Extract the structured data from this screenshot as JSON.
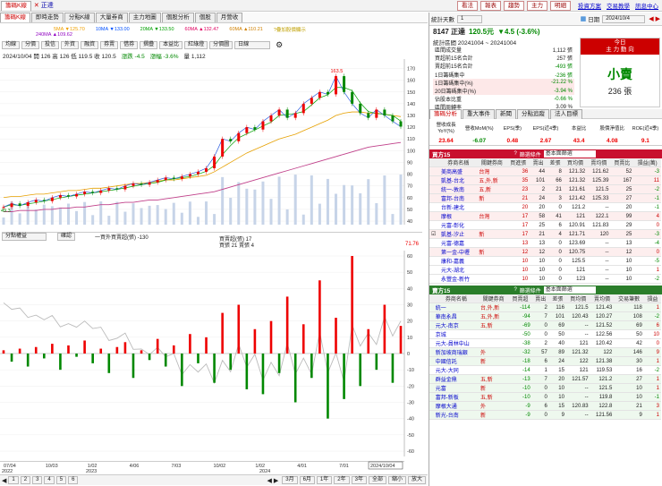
{
  "window": {
    "tab_label": "籌碼K線",
    "stock_label": "正達",
    "top_buttons": [
      "看法",
      "報表",
      "趨勢",
      "主力",
      "明細"
    ],
    "top_links": [
      "投資方案",
      "交易教學",
      "訊息中心"
    ]
  },
  "toolbar": {
    "tabs": [
      "籌碼K線",
      "即時走勢",
      "分點K線",
      "大量券商",
      "主力地圖",
      "個股分析",
      "個股",
      "月營收"
    ],
    "time_label": "日期",
    "date_value": "2024/10/4",
    "stat_label": "統計天數",
    "stat_days": "1"
  },
  "chart_controls": {
    "buttons": [
      "均線",
      "分價",
      "投信",
      "外資",
      "融資",
      "券賣",
      "借券",
      "摺疊",
      "本益比",
      "紅綠燈",
      "分價圖",
      "日線"
    ],
    "info": "2024/10/04 開 126 高 126 低 119.5 收 120.5",
    "change": "漲跌 -4.5",
    "pct": "漲幅 -3.6%",
    "volume": "量 1,112",
    "indicator_dropdown": "分點權益",
    "indicator_button": "確認",
    "indicator_info": "一買外買賣超(張) -130",
    "indicator_info2": "買賣超(張) 17",
    "indicator_info3": "買張 21 賣張 4",
    "right_value": "71.76",
    "tool_buttons": [
      "3月",
      "6月",
      "1年",
      "2年",
      "3年",
      "全部",
      "縮小",
      "放大"
    ],
    "page_tabs": [
      "1",
      "2",
      "3",
      "4",
      "5",
      "6"
    ]
  },
  "legend": {
    "items": [
      "5MA ▼125.70",
      "10MA ▼133.00",
      "20MA ▼133.50",
      "60MA ▲132.47",
      "60MA ▲110.21"
    ],
    "items2": [
      "240MA ▲109.62"
    ],
    "tip": "?疊加股價顯示"
  },
  "chart_data": {
    "type": "line",
    "title": "",
    "price_axis": [
      170,
      160,
      150,
      140,
      130,
      120,
      110,
      100,
      90,
      80,
      70,
      60,
      50,
      40
    ],
    "indicator_axis": [
      60,
      50,
      40,
      30,
      20,
      10,
      0,
      -10,
      -20,
      -30,
      -40,
      -50,
      -60
    ],
    "x_ticks": [
      "07/04",
      "10/03",
      "1/02",
      "4/06",
      "7/03",
      "10/02",
      "1/02",
      "4/01",
      "7/01",
      "2024/10/04"
    ],
    "year_labels": [
      "2022",
      "2023",
      "2024"
    ],
    "peak_label": "163.5",
    "low_label": "49.3",
    "ylim": [
      40,
      175
    ],
    "close": [
      52,
      55,
      53,
      56,
      58,
      57,
      60,
      62,
      61,
      63,
      65,
      64,
      66,
      68,
      67,
      70,
      72,
      71,
      73,
      75,
      77,
      76,
      78,
      80,
      82,
      85,
      95,
      110,
      108,
      115,
      120,
      118,
      125,
      130,
      135,
      128,
      132,
      140,
      145,
      150,
      148,
      163.5,
      150,
      140,
      132,
      128,
      135,
      130,
      125,
      120.5
    ],
    "ma_line": [
      60,
      61,
      61,
      62,
      63,
      63,
      64,
      65,
      66,
      66,
      67,
      68,
      68,
      69,
      70,
      71,
      72,
      72,
      73,
      74,
      75,
      75,
      76,
      77,
      78,
      79,
      82,
      86,
      90,
      94,
      98,
      101,
      104,
      107,
      110,
      112,
      114,
      117,
      120,
      123,
      126,
      130,
      132,
      133,
      133,
      132,
      132,
      131,
      130,
      129
    ],
    "long_ma": [
      48,
      48,
      49,
      49,
      49,
      50,
      50,
      51,
      51,
      52,
      52,
      53,
      54,
      54,
      55,
      56,
      56,
      57,
      58,
      58,
      59,
      60,
      61,
      62,
      63,
      64,
      65,
      67,
      69,
      71,
      73,
      75,
      77,
      79,
      81,
      83,
      85,
      87,
      89,
      91,
      93,
      95,
      97,
      99,
      101,
      103,
      104,
      105,
      106,
      107
    ],
    "net_buy": [
      2,
      -5,
      3,
      -8,
      4,
      -3,
      6,
      -10,
      5,
      -2,
      8,
      -6,
      3,
      -12,
      4,
      7,
      -15,
      2,
      -4,
      9,
      -8,
      5,
      -20,
      12,
      -6,
      10,
      -18,
      25,
      -10,
      30,
      -22,
      15,
      -25,
      20,
      -12,
      35,
      -30,
      18,
      -15,
      45,
      -40,
      22,
      -28,
      60,
      -20,
      15,
      -10,
      30,
      -18,
      17
    ]
  },
  "right_panel": {
    "stock_title": "8147 正達",
    "price": "120.5元",
    "change": "▼4.5 (-3.6%)",
    "period": "統計區間 20241004 ~ 20241004",
    "stats": [
      {
        "label": "區間成交量",
        "value": "1,112 張"
      },
      {
        "label": "買超前15名合計",
        "value": "257 張"
      },
      {
        "label": "賣超前15名合計",
        "value": "-493 張"
      },
      {
        "label": "1日籌碼集中",
        "value": "-236 張"
      },
      {
        "label": "1日籌碼集中(%)",
        "value": "-21.22 %"
      },
      {
        "label": "20日籌碼集中(%)",
        "value": "-3.94 %"
      },
      {
        "label": "佔股本比重",
        "value": "-0.66 %"
      },
      {
        "label": "區間周轉率",
        "value": "3.09 %"
      }
    ],
    "today_box": {
      "header": "今日",
      "sub": "主 力 動 向",
      "main": "小賣",
      "amount": "236 張"
    },
    "sub_tabs": [
      "籌碼分析",
      "重大事件",
      "新聞",
      "分點追蹤",
      "法人目標"
    ],
    "metrics": [
      {
        "label": "營收成長YoY(%)",
        "value": "23.64"
      },
      {
        "label": "營收MoM(%)",
        "value": "-6.07"
      },
      {
        "label": "EPS(季)",
        "value": "0.48"
      },
      {
        "label": "EPS(近4季)",
        "value": "2.67"
      },
      {
        "label": "本益比",
        "value": "43.4"
      },
      {
        "label": "股價淨值比",
        "value": "4.08"
      },
      {
        "label": "ROE(近4季)",
        "value": "9.1"
      }
    ]
  },
  "buy_table": {
    "title": "買方15",
    "dropdown_label": "篩選條件",
    "dropdown_value": "基本面篩選",
    "columns": [
      "",
      "券商名稱",
      "關鍵券商",
      "買進張",
      "賣出",
      "差張",
      "買均價",
      "賣均價",
      "買賣比",
      "損益(萬)"
    ],
    "rows": [
      [
        "",
        "美商高盛",
        "台灣",
        "36",
        "44",
        "8",
        "121.32",
        "121.62",
        "52",
        "-3"
      ],
      [
        "",
        "凱基-台北",
        "五,外,新",
        "35",
        "101",
        "66",
        "121.32",
        "125.39",
        "167",
        "11"
      ],
      [
        "",
        "統一-敦南",
        "五,新",
        "23",
        "2",
        "21",
        "121.61",
        "121.5",
        "25",
        "-2"
      ],
      [
        "",
        "富邦-台南",
        "新",
        "21",
        "24",
        "3",
        "121.42",
        "125.33",
        "27",
        "-1"
      ],
      [
        "",
        "台新-建北",
        "",
        "20",
        "20",
        "0",
        "121.2",
        "--",
        "20",
        "-1"
      ],
      [
        "",
        "摩根",
        "台灣",
        "17",
        "58",
        "41",
        "121",
        "122.1",
        "99",
        "4"
      ],
      [
        "",
        "元富-彰化",
        "",
        "17",
        "25",
        "6",
        "120.91",
        "121.83",
        "29",
        "0"
      ],
      [
        "☑",
        "凱基-汐止",
        "新",
        "17",
        "21",
        "4",
        "121.71",
        "120",
        "25",
        "-3"
      ],
      [
        "",
        "元富-德嘉",
        "",
        "13",
        "13",
        "0",
        "123.69",
        "--",
        "13",
        "-4"
      ],
      [
        "",
        "第一金-中壢",
        "新",
        "12",
        "12",
        "0",
        "120.75",
        "--",
        "12",
        "0"
      ],
      [
        "",
        "康和-嘉義",
        "",
        "10",
        "10",
        "0",
        "125.5",
        "--",
        "10",
        "-5"
      ],
      [
        "",
        "元大-湖北",
        "",
        "10",
        "10",
        "0",
        "121",
        "--",
        "10",
        "1"
      ],
      [
        "",
        "永豐金-新竹",
        "",
        "10",
        "10",
        "0",
        "123",
        "--",
        "10",
        "-2"
      ]
    ]
  },
  "sell_table": {
    "title": "賣方15",
    "dropdown_label": "篩選條件",
    "dropdown_value": "基本面篩選",
    "columns": [
      "",
      "券商名稱",
      "關鍵券商",
      "買賣超",
      "賣出",
      "差張",
      "買均價",
      "賣均價",
      "交易筆數",
      "損益"
    ],
    "rows": [
      [
        "",
        "統一",
        "台,外,新",
        "-114",
        "2",
        "116",
        "121.5",
        "121.43",
        "118",
        "1"
      ],
      [
        "",
        "華南永昌",
        "五,外,新",
        "-94",
        "7",
        "101",
        "120.43",
        "120.27",
        "108",
        "-2"
      ],
      [
        "",
        "元大-南京",
        "五,新",
        "-69",
        "0",
        "69",
        "--",
        "121.52",
        "69",
        "6"
      ],
      [
        "",
        "京城",
        "",
        "-50",
        "0",
        "50",
        "--",
        "122.56",
        "50",
        "10"
      ],
      [
        "",
        "元大-員林中山",
        "",
        "-38",
        "2",
        "40",
        "121",
        "120.42",
        "42",
        "0"
      ],
      [
        "",
        "新加坡商瑞銀",
        "外",
        "-32",
        "57",
        "89",
        "121.32",
        "122",
        "146",
        "9"
      ],
      [
        "",
        "中國信託",
        "新",
        "-18",
        "6",
        "24",
        "122",
        "121.38",
        "30",
        "1"
      ],
      [
        "",
        "元大-大同",
        "",
        "-14",
        "1",
        "15",
        "121",
        "119.53",
        "16",
        "-2"
      ],
      [
        "",
        "群益金鼎",
        "五,新",
        "-13",
        "7",
        "20",
        "121.57",
        "121.2",
        "27",
        "1"
      ],
      [
        "",
        "元富",
        "新",
        "-10",
        "0",
        "10",
        "--",
        "121.5",
        "10",
        "1"
      ],
      [
        "",
        "富邦-新板",
        "五,新",
        "-10",
        "0",
        "10",
        "--",
        "119.8",
        "10",
        "-1"
      ],
      [
        "",
        "摩根大通",
        "外",
        "-9",
        "6",
        "15",
        "120.83",
        "122.8",
        "21",
        "3"
      ],
      [
        "",
        "新光-台南",
        "新",
        "-9",
        "0",
        "9",
        "--",
        "121.56",
        "9",
        "1"
      ]
    ]
  }
}
